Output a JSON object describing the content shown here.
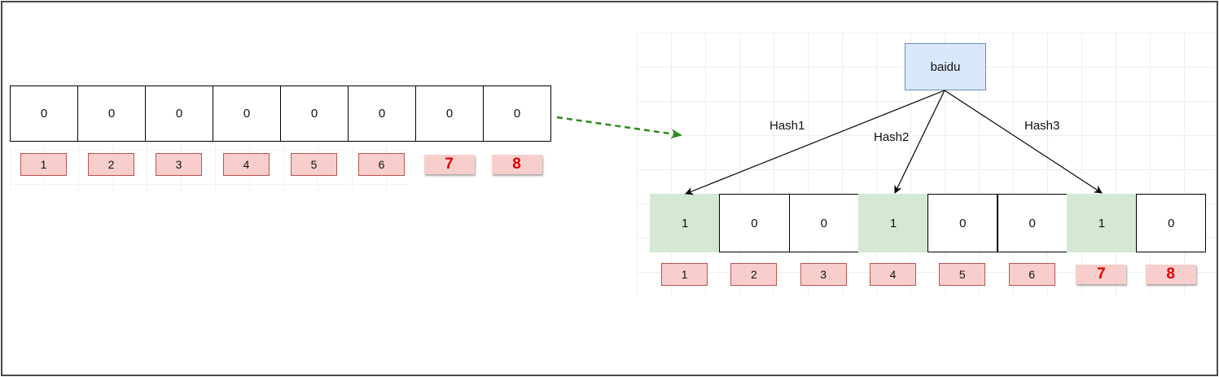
{
  "left_array": {
    "bits": [
      "0",
      "0",
      "0",
      "0",
      "0",
      "0",
      "0",
      "0"
    ],
    "indices": [
      "1",
      "2",
      "3",
      "4",
      "5",
      "6",
      "7",
      "8"
    ]
  },
  "right_diagram": {
    "source": "baidu",
    "hash_labels": [
      "Hash1",
      "Hash2",
      "Hash3"
    ],
    "bits": [
      "1",
      "0",
      "0",
      "1",
      "0",
      "0",
      "1",
      "0"
    ],
    "set_positions": [
      1,
      4,
      7
    ],
    "indices": [
      "1",
      "2",
      "3",
      "4",
      "5",
      "6",
      "7",
      "8"
    ]
  },
  "colors": {
    "cell_set": "#d5e8d4",
    "index_fill": "#f8cecc",
    "index_emphasis_text": "#e00000",
    "source_fill": "#dae8fc",
    "transition_arrow": "#2e8b1e"
  }
}
